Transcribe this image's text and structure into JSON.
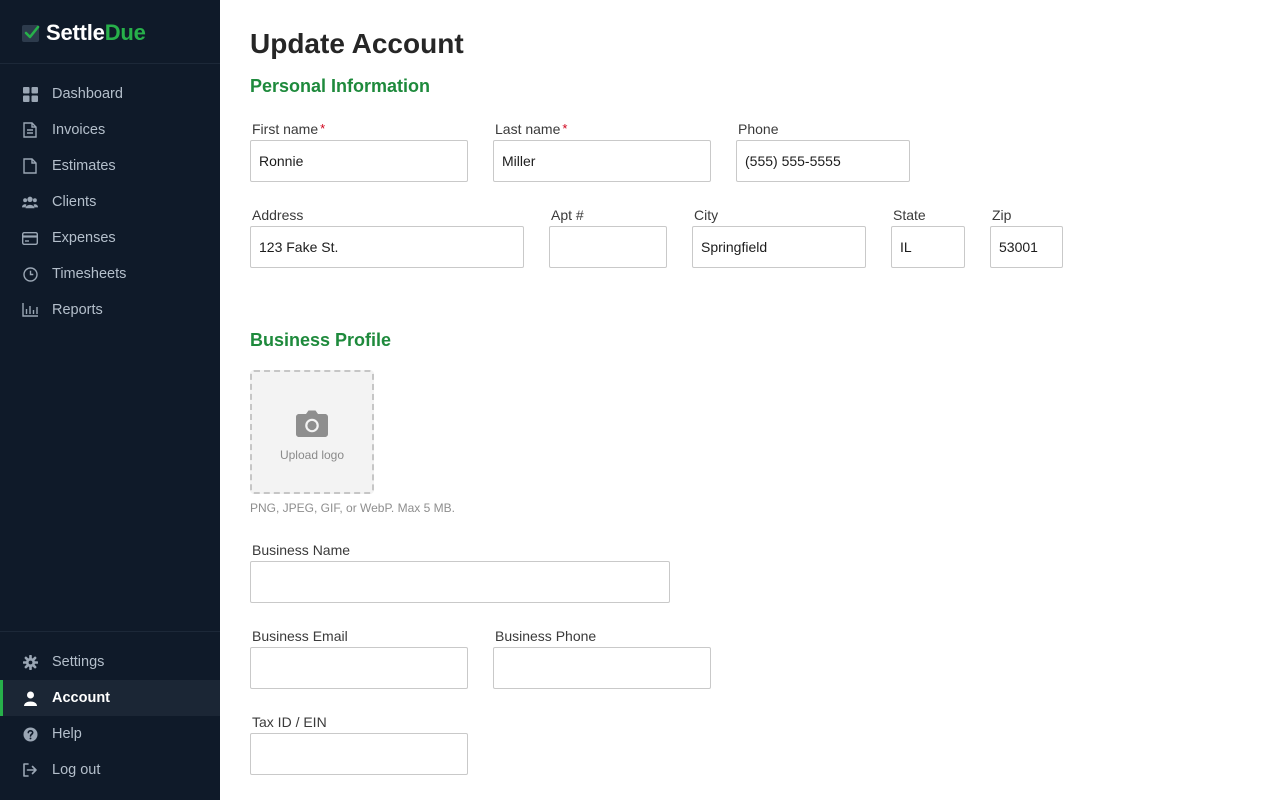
{
  "brand": {
    "part1": "Settle",
    "part2": "Due"
  },
  "sidebar": {
    "items": [
      {
        "label": "Dashboard",
        "icon": "dashboard-icon"
      },
      {
        "label": "Invoices",
        "icon": "invoice-icon"
      },
      {
        "label": "Estimates",
        "icon": "estimate-icon"
      },
      {
        "label": "Clients",
        "icon": "clients-icon"
      },
      {
        "label": "Expenses",
        "icon": "credit-card-icon"
      },
      {
        "label": "Timesheets",
        "icon": "clock-icon"
      },
      {
        "label": "Reports",
        "icon": "bar-chart-icon"
      }
    ],
    "footer_items": [
      {
        "label": "Settings",
        "icon": "gear-icon"
      },
      {
        "label": "Account",
        "icon": "user-icon",
        "active": true
      },
      {
        "label": "Help",
        "icon": "help-icon"
      },
      {
        "label": "Log out",
        "icon": "logout-icon"
      }
    ]
  },
  "page": {
    "title": "Update Account",
    "personal_title": "Personal Information",
    "business_title": "Business Profile"
  },
  "personal": {
    "first_name": {
      "label": "First name",
      "value": "Ronnie",
      "required": "*"
    },
    "last_name": {
      "label": "Last name",
      "value": "Miller",
      "required": "*"
    },
    "phone": {
      "label": "Phone",
      "value": "(555) 555-5555"
    },
    "address": {
      "label": "Address",
      "value": "123 Fake St."
    },
    "apt": {
      "label": "Apt #",
      "value": ""
    },
    "city": {
      "label": "City",
      "value": "Springfield"
    },
    "state": {
      "label": "State",
      "value": "IL"
    },
    "zip": {
      "label": "Zip",
      "value": "53001"
    }
  },
  "business": {
    "upload_label": "Upload logo",
    "upload_hint": "PNG, JPEG, GIF, or WebP. Max 5 MB.",
    "name": {
      "label": "Business Name",
      "value": ""
    },
    "email": {
      "label": "Business Email",
      "value": ""
    },
    "phone": {
      "label": "Business Phone",
      "value": ""
    },
    "tax_id": {
      "label": "Tax ID / EIN",
      "value": ""
    }
  },
  "colors": {
    "accent": "#27b04a",
    "section": "#1e8a3c",
    "sidebar_bg": "#0f1a29",
    "required": "#d0021b"
  }
}
